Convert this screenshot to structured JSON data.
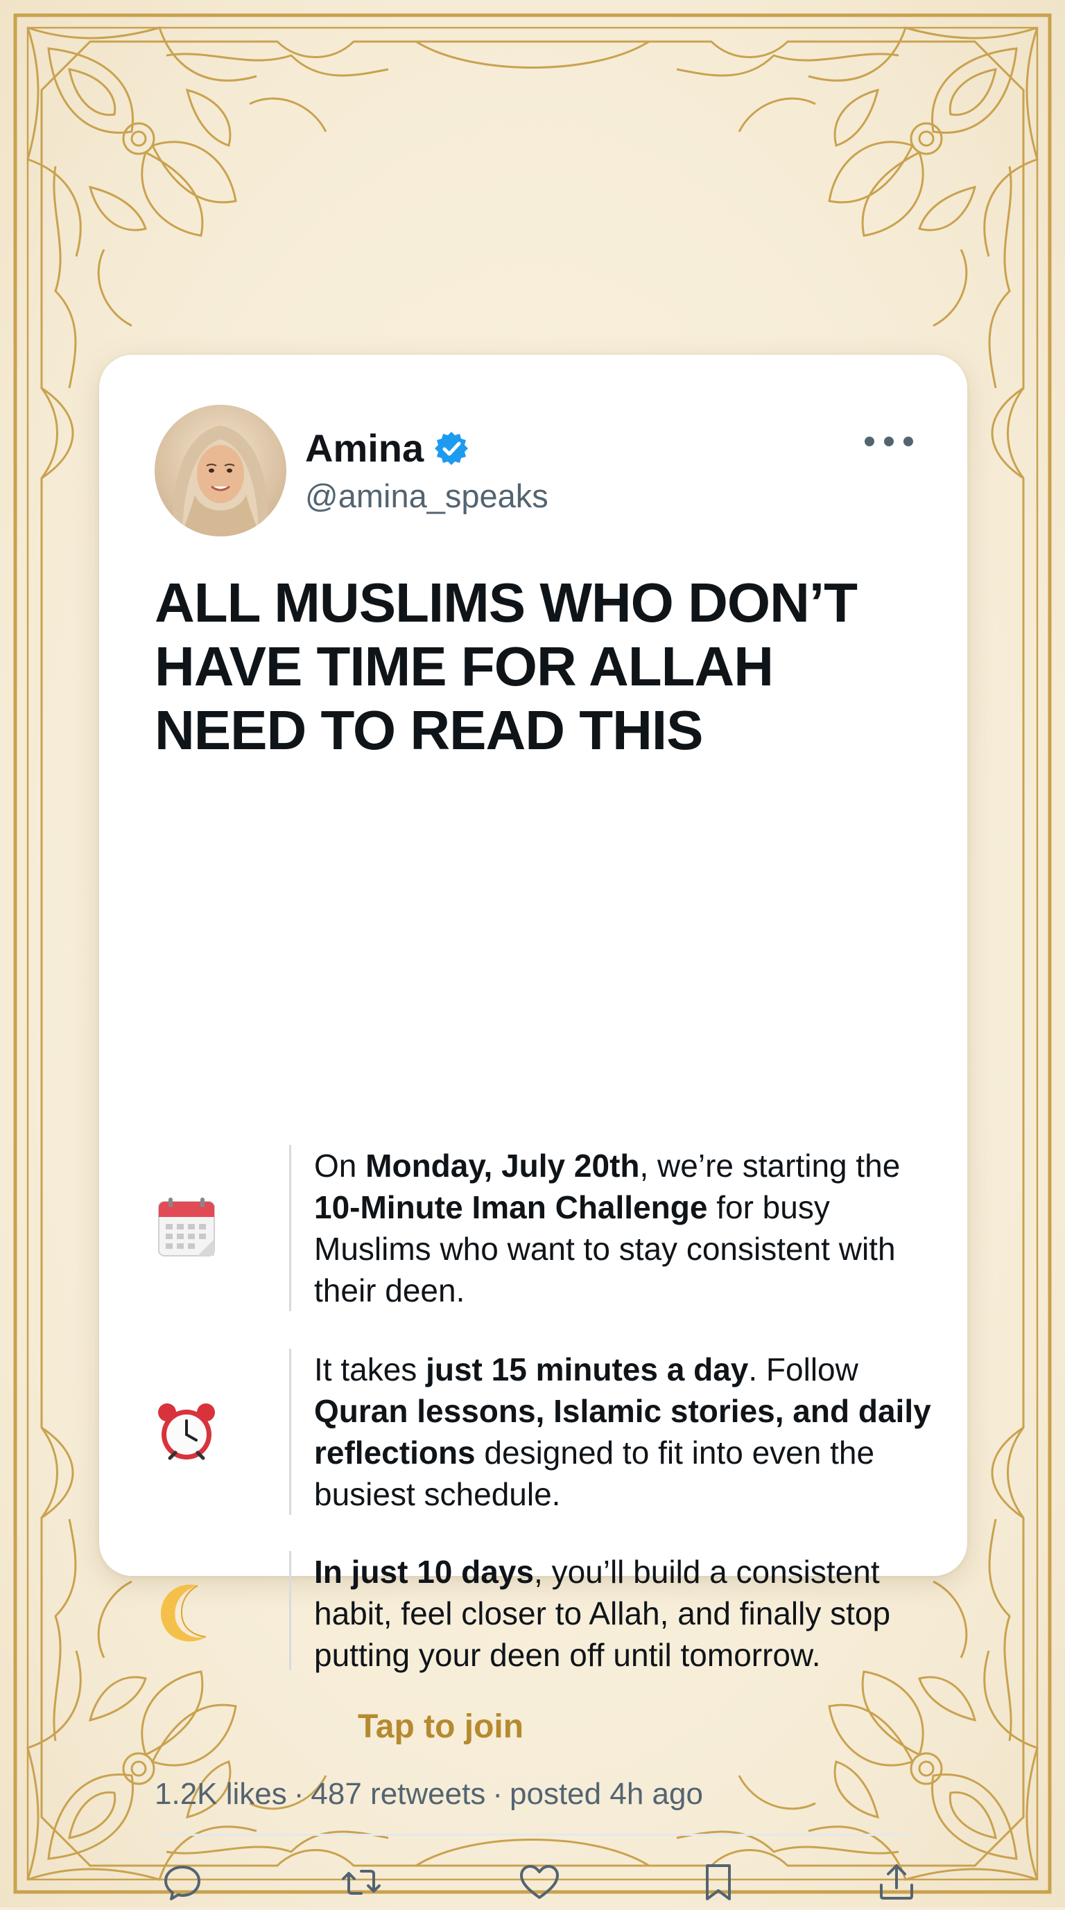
{
  "colors": {
    "background": "#f6ecd7",
    "ornament_gold": "#c9a24f",
    "card": "#ffffff",
    "accent_gold": "#b58a2f",
    "verified_blue": "#1d9bf0",
    "text_primary": "#0f1419",
    "text_secondary": "#536471"
  },
  "post": {
    "author": {
      "name": "Amina",
      "handle": "@amina_speaks",
      "verified": true,
      "verified_icon": "verified-badge-icon"
    },
    "more_icon": "more-options-icon",
    "headline": "ALL MUSLIMS WHO DON’T HAVE TIME FOR ALLAH NEED TO READ THIS",
    "items": [
      {
        "icon": "calendar-icon",
        "segments": [
          {
            "text": "On ",
            "bold": false
          },
          {
            "text": "Monday, July 20th",
            "bold": true
          },
          {
            "text": ", we’re starting the ",
            "bold": false
          },
          {
            "text": "10-Minute Iman Challenge",
            "bold": true
          },
          {
            "text": " for busy Muslims who want to stay consistent with their deen.",
            "bold": false
          }
        ]
      },
      {
        "icon": "alarm-clock-icon",
        "segments": [
          {
            "text": "It takes ",
            "bold": false
          },
          {
            "text": "just 15 minutes a day",
            "bold": true
          },
          {
            "text": ". Follow ",
            "bold": false
          },
          {
            "text": "Quran lessons, Islamic stories, and daily reflections",
            "bold": true
          },
          {
            "text": " designed to fit into even the busiest schedule.",
            "bold": false
          }
        ]
      },
      {
        "icon": "crescent-moon-icon",
        "segments": [
          {
            "text": "In just 10 days",
            "bold": true
          },
          {
            "text": ", you’ll build a consistent habit, feel closer to Allah, and finally stop putting your deen off until tomorrow.",
            "bold": false
          }
        ]
      }
    ],
    "cta": "Tap to join",
    "stats": {
      "likes": "1.2K likes",
      "retweets": "487 retweets",
      "posted": "posted 4h ago",
      "separator": "·"
    },
    "actions": [
      {
        "icon": "reply-icon"
      },
      {
        "icon": "retweet-icon"
      },
      {
        "icon": "heart-icon"
      },
      {
        "icon": "bookmark-icon"
      },
      {
        "icon": "share-icon"
      }
    ]
  }
}
